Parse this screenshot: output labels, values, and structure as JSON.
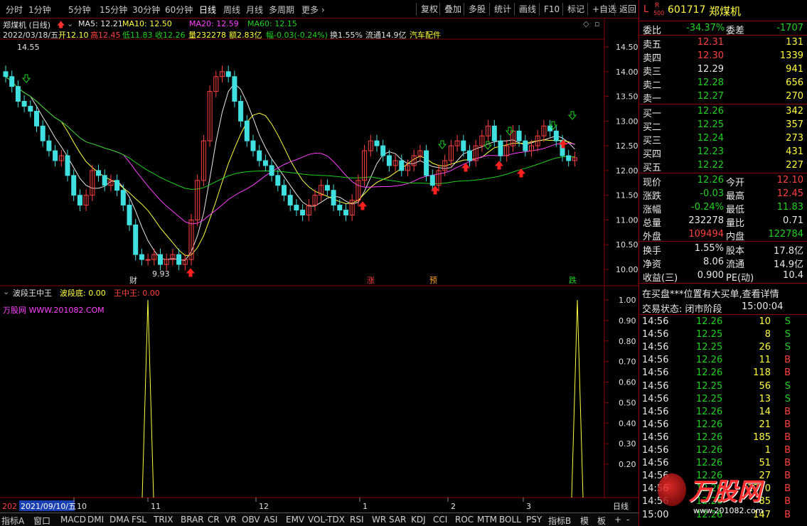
{
  "toolbar": {
    "periods": [
      "分时",
      "1分钟",
      "5分钟",
      "15分钟",
      "30分钟",
      "60分钟",
      "日线",
      "周线",
      "月线",
      "多周期",
      "更多"
    ],
    "active_period": "日线",
    "right_buttons": [
      "复权",
      "叠加",
      "多股",
      "统计",
      "画线",
      "F10",
      "标记",
      "+自选",
      "返回"
    ]
  },
  "header": {
    "stock_title": "郑煤机 (日线)",
    "ma5": "MA5: 12.21",
    "ma10": "MA10: 12.50",
    "ma20": "MA20: 12.59",
    "ma60": "MA60: 12.15",
    "date": "2022/03/18/五",
    "open": "开12.10",
    "high": "高12.45",
    "low": "低11.83",
    "close": "收12.26",
    "volume": "量232278",
    "amount": "额2.83亿",
    "change": "幅-0.03(-0.24%)",
    "turnover": "换1.55%",
    "float_cap": "流通14.9亿",
    "industry": "汽车配件"
  },
  "price_axis": [
    "14.50",
    "14.00",
    "13.50",
    "13.00",
    "12.50",
    "12.00",
    "11.50",
    "11.00",
    "10.50",
    "10.00"
  ],
  "price_marks": {
    "high": "14.55",
    "low": "9.93"
  },
  "event_labels": [
    "财",
    "涨",
    "预",
    "跌"
  ],
  "indicator": {
    "name": "波段王中王",
    "v1": "波段底: 0.00",
    "v2": "王中王: 0.00",
    "watermark": "万股网 WWW.201082.COM",
    "axis": [
      "1.00",
      "0.90",
      "0.80",
      "0.70",
      "0.60",
      "0.50",
      "0.40",
      "0.30",
      "0.20"
    ]
  },
  "date_axis": {
    "selected": "2021/09/10/五",
    "prefix": "202",
    "labels": [
      "10",
      "11",
      "12",
      "1",
      "2",
      "3"
    ],
    "right": "日线"
  },
  "tabs": [
    "指标A",
    "窗口",
    "MACD",
    "DMI",
    "DMA",
    "FSL",
    "TRIX",
    "BRAR",
    "CR",
    "VR",
    "OBV",
    "ASI",
    "EMV",
    "VOL-TDX",
    "RSI",
    "WR",
    "SAR",
    "KDJ",
    "CCI",
    "ROC",
    "MTM",
    "BOLL",
    "PSY",
    "指标B",
    "模",
    "板",
    "+",
    "-"
  ],
  "quote": {
    "code": "601717",
    "name": "郑煤机",
    "badge_l": "L",
    "badge_r": "R",
    "badge_500": "500",
    "weibi_label": "委比",
    "weibi": "-34.37%",
    "weicha_label": "委差",
    "weicha": "-1707",
    "asks": [
      {
        "label": "卖五",
        "price": "12.31",
        "vol": "131"
      },
      {
        "label": "卖四",
        "price": "12.30",
        "vol": "1339"
      },
      {
        "label": "卖三",
        "price": "12.29",
        "vol": "941"
      },
      {
        "label": "卖二",
        "price": "12.28",
        "vol": "656"
      },
      {
        "label": "卖一",
        "price": "12.27",
        "vol": "270"
      }
    ],
    "bids": [
      {
        "label": "买一",
        "price": "12.26",
        "vol": "342"
      },
      {
        "label": "买二",
        "price": "12.25",
        "vol": "357"
      },
      {
        "label": "买三",
        "price": "12.24",
        "vol": "273"
      },
      {
        "label": "买四",
        "price": "12.23",
        "vol": "431"
      },
      {
        "label": "买五",
        "price": "12.22",
        "vol": "227"
      }
    ],
    "stats": [
      {
        "l1": "现价",
        "v1": "12.26",
        "l2": "今开",
        "v2": "12.10",
        "c1": "green",
        "c2": "red"
      },
      {
        "l1": "涨跌",
        "v1": "-0.03",
        "l2": "最高",
        "v2": "12.45",
        "c1": "green",
        "c2": "red"
      },
      {
        "l1": "涨幅",
        "v1": "-0.24%",
        "l2": "最低",
        "v2": "11.83",
        "c1": "green",
        "c2": "green"
      },
      {
        "l1": "总量",
        "v1": "232278",
        "l2": "量比",
        "v2": "0.71",
        "c1": "white",
        "c2": "white"
      },
      {
        "l1": "外盘",
        "v1": "109494",
        "l2": "内盘",
        "v2": "122784",
        "c1": "red",
        "c2": "green"
      }
    ],
    "stats2": [
      {
        "l1": "换手",
        "v1": "1.55%",
        "l2": "股本",
        "v2": "17.8亿"
      },
      {
        "l1": "净资",
        "v1": "8.06",
        "l2": "流通",
        "v2": "14.9亿"
      },
      {
        "l1": "收益(三)",
        "v1": "0.900",
        "l2": "PE(动)",
        "v2": "10.4"
      }
    ],
    "notice": "在买盘***位置有大买单,查看详情",
    "status_label": "交易状态: 闭市阶段",
    "status_time": "15:00:04",
    "ticks": [
      {
        "t": "14:56",
        "p": "12.26",
        "v": "10",
        "d": "S"
      },
      {
        "t": "14:56",
        "p": "12.25",
        "v": "8",
        "d": "S"
      },
      {
        "t": "14:56",
        "p": "12.25",
        "v": "26",
        "d": "S"
      },
      {
        "t": "14:56",
        "p": "12.26",
        "v": "11",
        "d": "B"
      },
      {
        "t": "14:56",
        "p": "12.26",
        "v": "118",
        "d": "B"
      },
      {
        "t": "14:56",
        "p": "12.25",
        "v": "56",
        "d": "S"
      },
      {
        "t": "14:56",
        "p": "12.25",
        "v": "13",
        "d": "S"
      },
      {
        "t": "14:56",
        "p": "12.26",
        "v": "14",
        "d": "B"
      },
      {
        "t": "14:56",
        "p": "12.26",
        "v": "21",
        "d": "B"
      },
      {
        "t": "14:56",
        "p": "12.26",
        "v": "185",
        "d": "B"
      },
      {
        "t": "14:56",
        "p": "12.26",
        "v": "1",
        "d": "B"
      },
      {
        "t": "14:56",
        "p": "12.26",
        "v": "51",
        "d": "B"
      },
      {
        "t": "14:56",
        "p": "12.26",
        "v": "27",
        "d": "B"
      },
      {
        "t": "14:56",
        "p": "12.26",
        "v": "1270",
        "d": "B"
      },
      {
        "t": "14:56",
        "p": "12.26",
        "v": "85",
        "d": "B"
      },
      {
        "t": "15:00",
        "p": "12.26",
        "v": "147",
        "d": "B"
      }
    ],
    "logo": "万股网",
    "logo_url": "www.201082.com"
  },
  "colors": {
    "up": "#ff4040",
    "down": "#40e0e0",
    "ma5": "#e8e8e8",
    "ma10": "#ffff40",
    "ma20": "#ff40ff",
    "ma60": "#20d020"
  }
}
